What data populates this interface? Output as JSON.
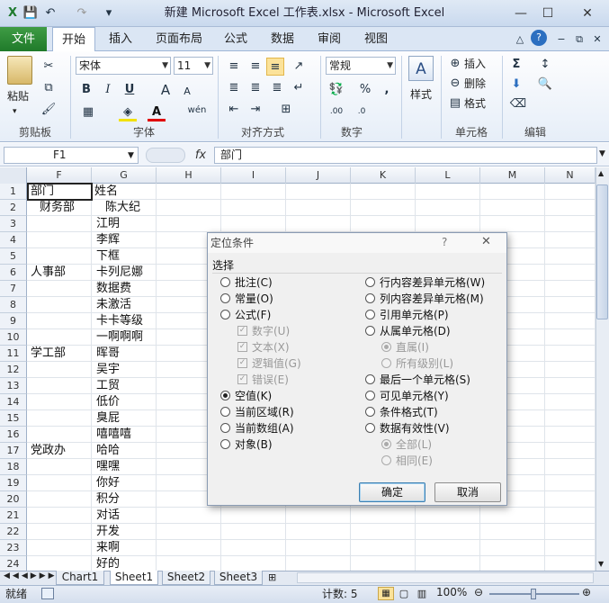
{
  "window": {
    "title": "新建 Microsoft Excel 工作表.xlsx - Microsoft Excel",
    "minimize": "—",
    "restore": "☐",
    "close": "✕"
  },
  "quick_access": {
    "save": "💾",
    "undo": "↶",
    "redo": "↷",
    "customize": "▾"
  },
  "ribbon_tabs": [
    "文件",
    "开始",
    "插入",
    "页面布局",
    "公式",
    "数据",
    "审阅",
    "视图"
  ],
  "ribbon": {
    "paste": "粘贴",
    "font_name": "宋体",
    "font_size": "11",
    "number_format": "常规",
    "styles": "样式",
    "insert": "插入",
    "delete": "删除",
    "format": "格式",
    "groups": [
      "剪贴板",
      "字体",
      "对齐方式",
      "数字",
      "单元格",
      "编辑"
    ],
    "percent": "%",
    "comma": ",",
    "bold": "B",
    "italic": "I",
    "underline": "U",
    "grow_font": "A",
    "shrink_font": "A",
    "wen": "wén"
  },
  "formula_bar": {
    "name_box": "F1",
    "fx": "fx",
    "value": "部门"
  },
  "columns": [
    "F",
    "G",
    "H",
    "I",
    "J",
    "K",
    "L",
    "M",
    "N"
  ],
  "rows": [
    "1",
    "2",
    "3",
    "4",
    "5",
    "6",
    "7",
    "8",
    "9",
    "10",
    "11",
    "12",
    "13",
    "14",
    "15",
    "16",
    "17",
    "18",
    "19",
    "20",
    "21",
    "22",
    "23",
    "24"
  ],
  "cells_f": [
    "部门",
    "财务部",
    "",
    "",
    "",
    "人事部",
    "",
    "",
    "",
    "",
    "学工部",
    "",
    "",
    "",
    "",
    "",
    "党政办",
    "",
    "",
    "",
    "",
    "",
    "",
    ""
  ],
  "cells_g": [
    "姓名",
    "陈大纪",
    "江明",
    "李辉",
    "下框",
    "卡列尼娜",
    "数据费",
    "未激活",
    "卡卡等级",
    "一啊啊啊",
    "晖哥",
    "吴宇",
    "工贸",
    "低价",
    "臭屁",
    "嘻嘻嘻",
    "哈哈",
    "嘿嘿",
    "你好",
    "积分",
    "对话",
    "开发",
    "来啊",
    "好的"
  ],
  "sheet_tabs": [
    "Chart1",
    "Sheet1",
    "Sheet2",
    "Sheet3"
  ],
  "status": {
    "mode": "就绪",
    "count": "计数: 5",
    "zoom": "100%"
  },
  "dialog": {
    "title": "定位条件",
    "help": "?",
    "close": "✕",
    "section": "选择",
    "left_options": [
      "批注(C)",
      "常量(O)",
      "公式(F)"
    ],
    "formula_sub": [
      "数字(U)",
      "文本(X)",
      "逻辑值(G)",
      "错误(E)"
    ],
    "left_options2": [
      "空值(K)",
      "当前区域(R)",
      "当前数组(A)",
      "对象(B)"
    ],
    "right_options": [
      "行内容差异单元格(W)",
      "列内容差异单元格(M)",
      "引用单元格(P)",
      "从属单元格(D)"
    ],
    "dependent_sub": [
      "直属(I)",
      "所有级别(L)"
    ],
    "right_options2": [
      "最后一个单元格(S)",
      "可见单元格(Y)",
      "条件格式(T)",
      "数据有效性(V)"
    ],
    "validation_sub": [
      "全部(L)",
      "相同(E)"
    ],
    "ok": "确定",
    "cancel": "取消"
  },
  "colors": {
    "file_tab": "#2a8a35",
    "dialog_bg": "#f0f0f0",
    "ribbon_bg": "#e6eef8"
  }
}
